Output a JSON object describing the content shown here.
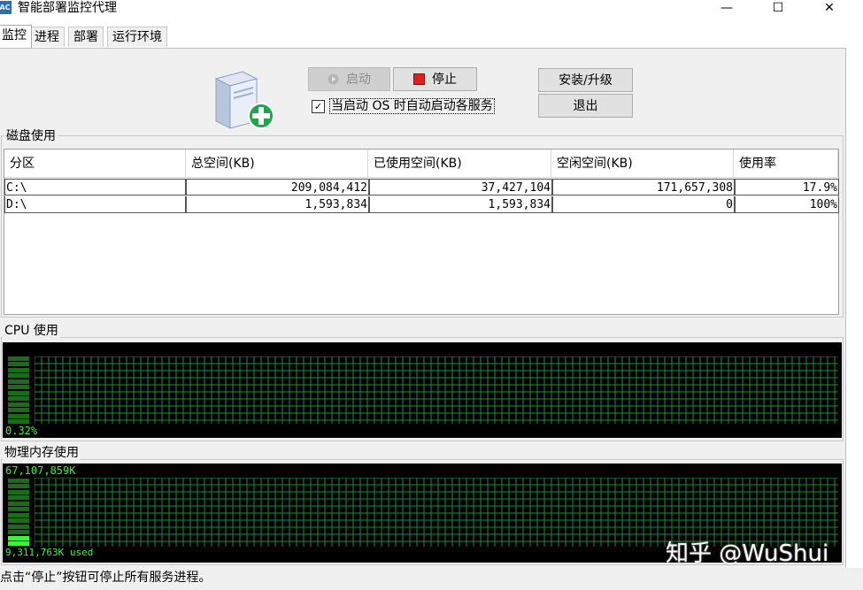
{
  "window": {
    "title": "智能部署监控代理",
    "icon": "app-logo-icon",
    "icon_text": "AC",
    "minimize": "—",
    "maximize": "☐",
    "close": "✕"
  },
  "tabs": [
    {
      "label": "监控",
      "active": true
    },
    {
      "label": "进程",
      "active": false
    },
    {
      "label": "部署",
      "active": false
    },
    {
      "label": "运行环境",
      "active": false
    }
  ],
  "controls": {
    "start_label": "启动",
    "stop_label": "停止",
    "install_label": "安装/升级",
    "exit_label": "退出",
    "autostart_label": "当启动 OS 时自动启动各服务",
    "autostart_checked": true,
    "check_mark": "✓"
  },
  "disk": {
    "group_title": "磁盘使用",
    "columns": [
      "分区",
      "总空间(KB)",
      "已使用空间(KB)",
      "空闲空间(KB)",
      "使用率"
    ],
    "rows": [
      [
        "C:\\",
        "209,084,412",
        "37,427,104",
        "171,657,308",
        "17.9%"
      ],
      [
        "D:\\",
        "1,593,834",
        "1,593,834",
        "0",
        "100%"
      ]
    ]
  },
  "cpu": {
    "group_title": "CPU 使用",
    "value_label": "0.32%",
    "usage_fraction": 0.0032
  },
  "memory": {
    "group_title": "物理内存使用",
    "total_label": "67,107,859K",
    "used_label": "9,311,763K used",
    "usage_fraction": 0.139
  },
  "status_bar": {
    "text": "点击“停止”按钮可停止所有服务进程。"
  },
  "watermark": "知乎 @WuShui",
  "colors": {
    "monitor_bg": "#000000",
    "grid": "#1f8a3a",
    "bar_on": "#3ef23e",
    "bar_off": "#1a6b1a",
    "stop_red": "#e02020"
  }
}
